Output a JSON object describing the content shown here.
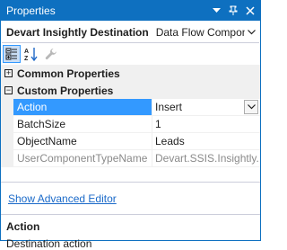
{
  "window": {
    "title": "Properties"
  },
  "selector": {
    "object_name": "Devart Insightly Destination",
    "object_type": "Data Flow Compone"
  },
  "toolbar": {
    "buttons": [
      {
        "icon": "categorized-icon",
        "active": true
      },
      {
        "icon": "alphabetical-icon",
        "active": false
      },
      {
        "icon": "property-pages-icon",
        "active": false
      }
    ]
  },
  "grid": {
    "common_category": {
      "label": "Common Properties",
      "expander": "+"
    },
    "custom_category": {
      "label": "Custom Properties",
      "expander": "−"
    },
    "rows": [
      {
        "name": "Action",
        "value": "Insert"
      },
      {
        "name": "BatchSize",
        "value": "1"
      },
      {
        "name": "ObjectName",
        "value": "Leads"
      },
      {
        "name": "UserComponentTypeName",
        "value": "Devart.SSIS.Insightly.In"
      }
    ]
  },
  "commands": {
    "advanced_editor_link": "Show Advanced Editor"
  },
  "description": {
    "title": "Action",
    "text": "Destination action"
  },
  "colors": {
    "titlebar": "#0e70c0",
    "selection": "#3399ff",
    "link": "#1b6ac9"
  }
}
